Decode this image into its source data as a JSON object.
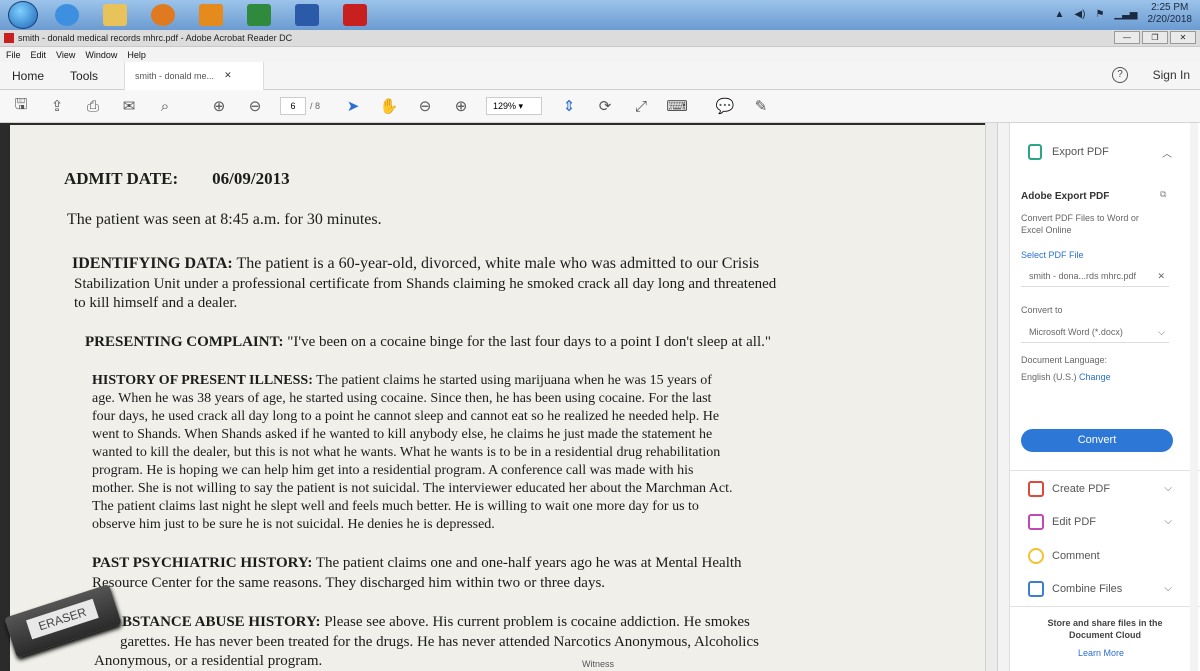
{
  "taskbar": {
    "clock_time": "2:25 PM",
    "clock_date": "2/20/2018",
    "apps": [
      {
        "name": "start-orb-icon"
      },
      {
        "name": "internet-explorer-icon",
        "color": "#3d8fe0"
      },
      {
        "name": "file-explorer-icon",
        "color": "#e8c25a"
      },
      {
        "name": "media-player-icon",
        "color": "#e07a20"
      },
      {
        "name": "outlook-icon",
        "color": "#e58a1c"
      },
      {
        "name": "excel-icon",
        "color": "#2f8a3e"
      },
      {
        "name": "word-icon",
        "color": "#2b5aa8"
      },
      {
        "name": "acrobat-icon",
        "color": "#c8201e"
      }
    ]
  },
  "window": {
    "title": "smith - donald medical records mhrc.pdf - Adobe Acrobat Reader DC"
  },
  "menu": [
    "File",
    "Edit",
    "View",
    "Window",
    "Help"
  ],
  "tabs": {
    "home": "Home",
    "tools": "Tools",
    "doc_tab": "smith - donald me...",
    "sign_in": "Sign In",
    "help": "?"
  },
  "toolbar": {
    "page_current": "6",
    "page_total": "/ 8",
    "zoom": "129%"
  },
  "document": {
    "lines": [
      {
        "text": "ADMIT DATE:        06/09/2013",
        "bold": true
      },
      {
        "text": "The patient was seen at 8:45 a.m. for 30 minutes."
      },
      {
        "text": "IDENTIFYING DATA:  The patient is a 60-year-old, divorced, white male who was admitted to our Crisis"
      },
      {
        "text": "Stabilization Unit under a professional certificate from Shands claiming he smoked crack all day long and threatened"
      },
      {
        "text": "to kill himself and a dealer."
      },
      {
        "text": "PRESENTING COMPLAINT:  \"I've been on a cocaine binge for the last four days to a point I don't sleep at all.\""
      },
      {
        "text": "HISTORY OF PRESENT ILLNESS:  The patient claims he started using marijuana when he was 15 years of"
      },
      {
        "text": "age.  When he was 38 years of age, he started using cocaine.  Since then, he has been using cocaine.  For the last"
      },
      {
        "text": "four days, he used crack all day long to a point he cannot sleep and cannot eat so he realized he needed help.  He"
      },
      {
        "text": "went to Shands.  When Shands asked if he wanted to kill anybody else, he claims he just made the statement he"
      },
      {
        "text": "wanted to kill the dealer, but this is not what he wants.  What he wants is to be in a residential drug rehabilitation"
      },
      {
        "text": "program.  He is hoping we can help him get into a residential program.  A conference call was made with his"
      },
      {
        "text": "mother.  She is not willing to say the patient is not suicidal.  The interviewer educated her about the Marchman Act."
      },
      {
        "text": "The patient claims last night he slept well and feels much better.  He is willing to wait one more day for us to"
      },
      {
        "text": "observe him just to be sure he is not suicidal.  He denies he is depressed."
      },
      {
        "text": "PAST PSYCHIATRIC HISTORY:  The patient claims one and one-half years ago he was at Mental Health"
      },
      {
        "text": "Resource Center for the same reasons.  They discharged him within two or three days."
      },
      {
        "text": "BSTANCE ABUSE HISTORY:  Please see above.  His current problem is cocaine addiction.  He smokes"
      },
      {
        "text": "garettes.  He has never been treated for the drugs.  He has never attended Narcotics Anonymous, Alcoholics"
      },
      {
        "text": "Anonymous, or a residential program."
      }
    ],
    "footer_stamp": "Witness"
  },
  "panel": {
    "export_title": "Export PDF",
    "adobe_export_title": "Adobe Export PDF",
    "adobe_export_desc": "Convert PDF Files to Word or Excel Online",
    "select_file_label": "Select PDF File",
    "selected_file": "smith - dona...rds mhrc.pdf",
    "convert_to_label": "Convert to",
    "convert_to_value": "Microsoft Word (*.docx)",
    "doc_language_label": "Document Language:",
    "doc_language_value": "English (U.S.)",
    "change_link": "Change",
    "convert_button": "Convert",
    "tools": [
      "Create PDF",
      "Edit PDF",
      "Comment",
      "Combine Files"
    ],
    "store_text": "Store and share files in the Document Cloud",
    "learn_more": "Learn More"
  },
  "overlay": {
    "eraser_label": "ERASER"
  }
}
